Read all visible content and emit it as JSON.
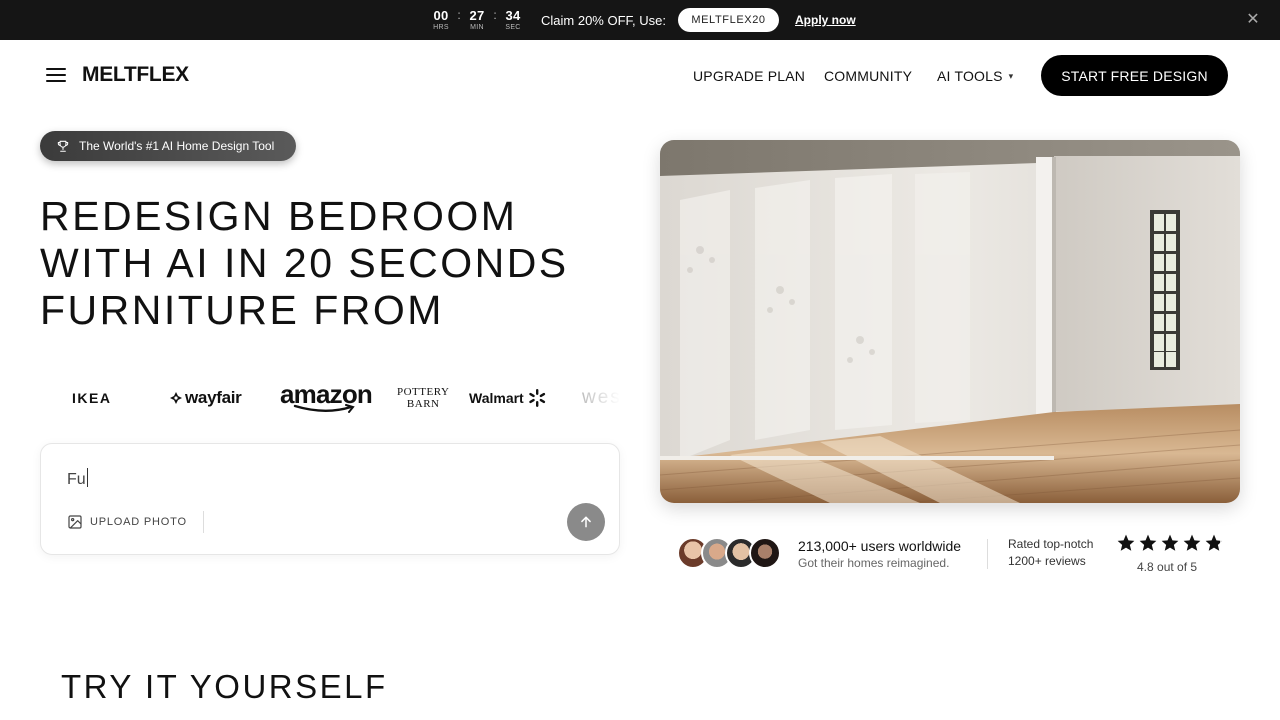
{
  "promo": {
    "timer": [
      {
        "value": "00",
        "label": "HRS"
      },
      {
        "value": "27",
        "label": "MIN"
      },
      {
        "value": "34",
        "label": "SEC"
      }
    ],
    "separator": ":",
    "text": "Claim 20% OFF, Use:",
    "code": "MELTFLEX20",
    "apply_label": "Apply now",
    "close_icon": "close-icon"
  },
  "header": {
    "logo": "MELTFLEX",
    "nav": {
      "upgrade": "UPGRADE PLAN",
      "community": "COMMUNITY",
      "ai_tools": "AI TOOLS"
    },
    "cta": "START FREE DESIGN"
  },
  "hero": {
    "badge": "The World's #1 AI Home Design Tool",
    "title_lines": [
      "REDESIGN BEDROOM",
      "WITH AI IN 20 SECONDS",
      "FURNITURE FROM"
    ],
    "brands": {
      "ikea": "IKEA",
      "wayfair": "wayfair",
      "amazon": "amazon",
      "pottery_line1": "POTTERY",
      "pottery_line2": "BARN",
      "walmart": "Walmart",
      "west": "wes"
    },
    "input": {
      "value": "Fu",
      "upload_label": "UPLOAD PHOTO"
    }
  },
  "social": {
    "users_main": "213,000+ users worldwide",
    "users_sub": "Got their homes reimagined.",
    "rated": "Rated top-notch",
    "reviews": "1200+ reviews",
    "rating": 4.8,
    "rating_text": "4.8 out of 5"
  },
  "section": {
    "title": "TRY IT YOURSELF"
  },
  "colors": {
    "promo_bg": "#151515",
    "cta_bg": "#000000",
    "send_bg": "#8a8a8a"
  }
}
